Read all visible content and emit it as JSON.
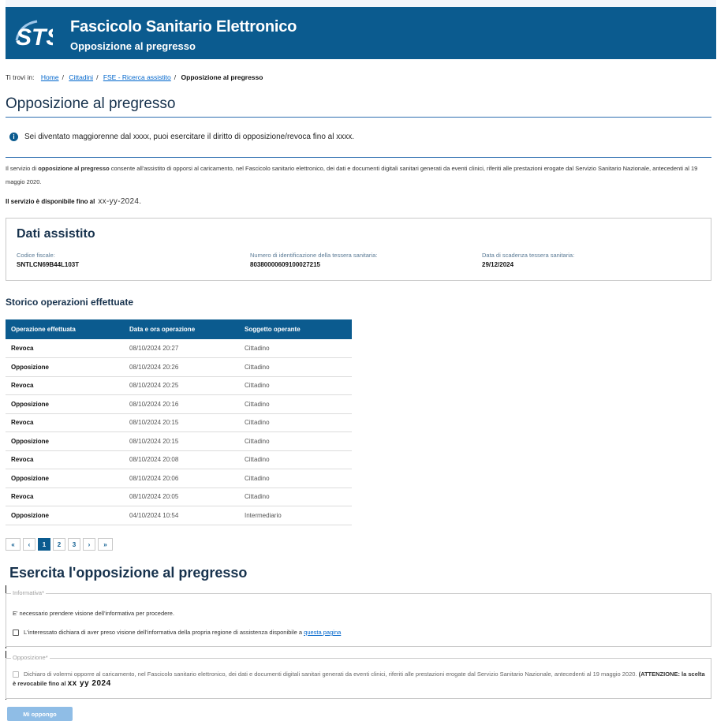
{
  "header": {
    "title": "Fascicolo Sanitario Elettronico",
    "subtitle": "Opposizione al pregresso",
    "logo_text": "STS"
  },
  "breadcrumb": {
    "prefix": "Ti trovi in:",
    "items": [
      "Home",
      "Cittadini",
      "FSE - Ricerca assistito"
    ],
    "current": "Opposizione al pregresso"
  },
  "page_title": "Opposizione al pregresso",
  "info_message": "Sei diventato maggiorenne dal xxxx, puoi esercitare il diritto di opposizione/revoca fino al xxxx.",
  "description": {
    "before_bold": "Il servizio di ",
    "bold": "opposizione al pregresso",
    "after_bold": " consente all'assistito di opporsi al caricamento, nel Fascicolo sanitario elettronico, dei dati e documenti digitali sanitari generati da eventi clinici, riferiti alle prestazioni erogate dal Servizio Sanitario Nazionale, antecedenti al 19 maggio 2020."
  },
  "availability": {
    "label": "Il servizio è disponibile fino al",
    "date": "xx-yy-2024."
  },
  "dati_assistito": {
    "title": "Dati assistito",
    "fields": [
      {
        "label": "Codice fiscale:",
        "value": "SNTLCN69B44L103T"
      },
      {
        "label": "Numero di identificazione della tessera sanitaria:",
        "value": "80380000609100027215"
      },
      {
        "label": "Data di scadenza tessera sanitaria:",
        "value": "29/12/2024"
      }
    ]
  },
  "storico": {
    "title": "Storico operazioni effettuate",
    "columns": [
      "Operazione effettuata",
      "Data e ora operazione",
      "Soggetto operante"
    ],
    "rows": [
      [
        "Revoca",
        "08/10/2024 20:27",
        "Cittadino"
      ],
      [
        "Opposizione",
        "08/10/2024 20:26",
        "Cittadino"
      ],
      [
        "Revoca",
        "08/10/2024 20:25",
        "Cittadino"
      ],
      [
        "Opposizione",
        "08/10/2024 20:16",
        "Cittadino"
      ],
      [
        "Revoca",
        "08/10/2024 20:15",
        "Cittadino"
      ],
      [
        "Opposizione",
        "08/10/2024 20:15",
        "Cittadino"
      ],
      [
        "Revoca",
        "08/10/2024 20:08",
        "Cittadino"
      ],
      [
        "Opposizione",
        "08/10/2024 20:06",
        "Cittadino"
      ],
      [
        "Revoca",
        "08/10/2024 20:05",
        "Cittadino"
      ],
      [
        "Opposizione",
        "04/10/2024 10:54",
        "Intermediario"
      ]
    ]
  },
  "pagination": {
    "first": "«",
    "prev": "‹",
    "pages": [
      "1",
      "2",
      "3"
    ],
    "current": "1",
    "next": "›",
    "last": "»"
  },
  "esercita": {
    "title": "Esercita l'opposizione al pregresso",
    "informativa": {
      "legend": "Informativa*",
      "note": "E' necessario prendere visione dell'informativa per procedere.",
      "checkbox_text": "L'interessato dichiara di aver preso visione dell'informativa della propria regione di assistenza disponibile a ",
      "link_text": "questa pagina"
    },
    "opposizione": {
      "legend": "Opposizione*",
      "checkbox_text": "Dichiaro di volermi opporre al caricamento, nel Fascicolo sanitario elettronico, dei dati e documenti digitali sanitari generati da eventi clinici, riferiti alle prestazioni erogate dal Servizio Sanitario Nazionale, antecedenti al 19 maggio 2020. ",
      "warning_bold": "(ATTENZIONE: la scelta è revocabile fino al",
      "warning_date": "xx yy 2024"
    },
    "button": "Mi oppongo"
  },
  "colors": {
    "header_bg": "#0b5b8f",
    "title_color": "#17324d",
    "link": "#0066cc",
    "button_disabled": "#8fbde6"
  }
}
